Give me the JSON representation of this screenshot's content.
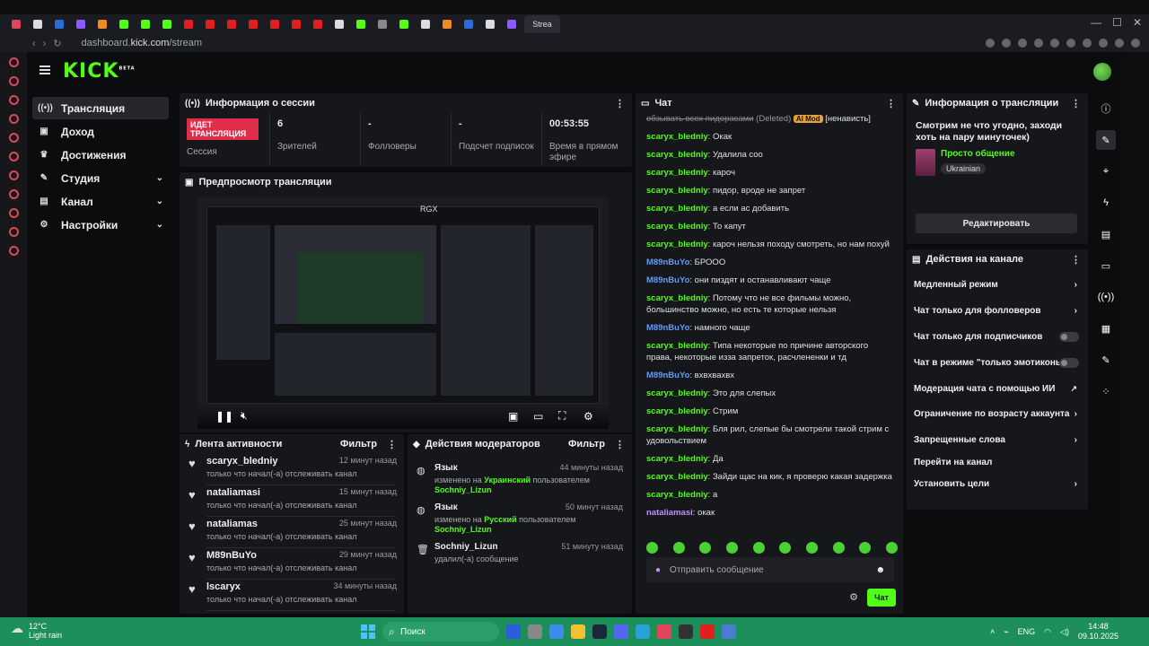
{
  "browser": {
    "active_tab_label": "Strea",
    "url_prefix": "dashboard.",
    "url_domain": "kick.com",
    "url_path": "/stream"
  },
  "app": {
    "logo": "KICK",
    "logo_badge": "BETA"
  },
  "sidebar": {
    "items": [
      {
        "label": "Трансляция",
        "icon": "broadcast-icon"
      },
      {
        "label": "Доход",
        "icon": "wallet-icon"
      },
      {
        "label": "Достижения",
        "icon": "trophy-icon"
      },
      {
        "label": "Студия",
        "icon": "studio-icon"
      },
      {
        "label": "Канал",
        "icon": "channel-icon"
      },
      {
        "label": "Настройки",
        "icon": "gear-icon"
      }
    ]
  },
  "session": {
    "title": "Информация о сессии",
    "live_badge": "ИДЕТ ТРАНСЛЯЦИЯ",
    "session_label": "Сессия",
    "viewers_value": "6",
    "viewers_label": "Зрителей",
    "followers_value": "-",
    "followers_label": "Фолловеры",
    "subs_value": "-",
    "subs_label": "Подсчет подписок",
    "uptime_value": "00:53:55",
    "uptime_label": "Время в прямом эфире"
  },
  "preview": {
    "title": "Предпросмотр трансляции",
    "overlay_label": "RGX"
  },
  "activity": {
    "title": "Лента активности",
    "filter": "Фильтр",
    "items": [
      {
        "name": "scaryx_bledniy",
        "time": "12 минут назад",
        "desc": "только что начал(-а) отслеживать канал"
      },
      {
        "name": "nataliamasi",
        "time": "15 минут назад",
        "desc": "только что начал(-а) отслеживать канал"
      },
      {
        "name": "nataliamas",
        "time": "25 минут назад",
        "desc": "только что начал(-а) отслеживать канал"
      },
      {
        "name": "M89nBuYo",
        "time": "29 минут назад",
        "desc": "только что начал(-а) отслеживать канал"
      },
      {
        "name": "lscaryx",
        "time": "34 минуты назад",
        "desc": "только что начал(-а) отслеживать канал"
      }
    ]
  },
  "modactions": {
    "title": "Действия модераторов",
    "filter": "Фильтр",
    "items": [
      {
        "name": "Язык",
        "time": "44 минуты назад",
        "pre": "изменено на ",
        "hl": "Украинский",
        "mid": " пользователем ",
        "user": "Sochniy_Lizun"
      },
      {
        "name": "Язык",
        "time": "50 минут назад",
        "pre": "изменено на ",
        "hl": "Русский",
        "mid": " пользователем ",
        "user": "Sochniy_Lizun"
      },
      {
        "name": "Sochniy_Lizun",
        "time": "51 минуту назад",
        "pre": "удалил(-а) сообщение",
        "hl": "",
        "mid": "",
        "user": ""
      }
    ]
  },
  "chat": {
    "title": "Чат",
    "deleted_text": "обзывать всех пидорасами",
    "deleted_tag": "(Deleted)",
    "aimod_tag": "AI Mod",
    "reason_tag": "[ненависть]",
    "messages": [
      {
        "user": "scaryx_bledniy",
        "text": "Окак",
        "color": "g"
      },
      {
        "user": "scaryx_bledniy",
        "text": "Удалила соо",
        "color": "g"
      },
      {
        "user": "scaryx_bledniy",
        "text": "кароч",
        "color": "g"
      },
      {
        "user": "scaryx_bledniy",
        "text": "пидор, вроде не запрет",
        "color": "g"
      },
      {
        "user": "scaryx_bledniy",
        "text": "а если ас добавить",
        "color": "g"
      },
      {
        "user": "scaryx_bledniy",
        "text": "То капут",
        "color": "g"
      },
      {
        "user": "scaryx_bledniy",
        "text": "кароч нельзя походу смотреть, но нам похуй",
        "color": "g"
      },
      {
        "user": "M89nBuYo",
        "text": "БРООО",
        "color": "b"
      },
      {
        "user": "M89nBuYo",
        "text": "они пиздят и останавливают чаще",
        "color": "b"
      },
      {
        "user": "scaryx_bledniy",
        "text": "Потому что не все фильмы можно, большинство можно, но есть те которые нельзя",
        "color": "g"
      },
      {
        "user": "M89nBuYo",
        "text": "намного чаще",
        "color": "b"
      },
      {
        "user": "scaryx_bledniy",
        "text": "Типа некоторые по причине авторского права, некоторые изза запреток, расчлененки и тд",
        "color": "g"
      },
      {
        "user": "M89nBuYo",
        "text": "вхвхвахвх",
        "color": "b"
      },
      {
        "user": "scaryx_bledniy",
        "text": "Это для слепых",
        "color": "g"
      },
      {
        "user": "scaryx_bledniy",
        "text": "Стрим",
        "color": "g"
      },
      {
        "user": "scaryx_bledniy",
        "text": "Бля рил, слепые бы смотрели такой стрим с удовольствием",
        "color": "g"
      },
      {
        "user": "scaryx_bledniy",
        "text": "Да",
        "color": "g"
      },
      {
        "user": "scaryx_bledniy",
        "text": "Зайди щас на кик, я проверю какая задержка",
        "color": "g"
      },
      {
        "user": "scaryx_bledniy",
        "text": "а",
        "color": "g"
      },
      {
        "user": "nataliamasi",
        "text": "окак",
        "color": "p"
      }
    ],
    "input_placeholder": "Отправить сообщение",
    "send_label": "Чат"
  },
  "streaminfo": {
    "title": "Информация о трансляции",
    "stream_title": "Смотрим не что угодно, заходи хоть на пару минуточек)",
    "category": "Просто общение",
    "tag": "Ukrainian",
    "edit_label": "Редактировать"
  },
  "channel_actions": {
    "title": "Действия на канале",
    "items": [
      {
        "label": "Медленный режим",
        "type": "chevron"
      },
      {
        "label": "Чат только для фолловеров",
        "type": "chevron"
      },
      {
        "label": "Чат только для подписчиков",
        "type": "toggle"
      },
      {
        "label": "Чат в режиме \"только эмотиконы\"",
        "type": "toggle"
      },
      {
        "label": "Модерация чата с помощью ИИ",
        "type": "external"
      },
      {
        "label": "Ограничение по возрасту аккаунта",
        "type": "chevron"
      },
      {
        "label": "Запрещенные слова",
        "type": "chevron"
      },
      {
        "label": "Перейти на канал",
        "type": "none"
      },
      {
        "label": "Установить цели",
        "type": "chevron"
      }
    ]
  },
  "taskbar": {
    "temperature": "12°C",
    "weather": "Light rain",
    "search": "Поиск",
    "lang": "ENG",
    "time": "14:48",
    "date": "09.10.2025"
  }
}
